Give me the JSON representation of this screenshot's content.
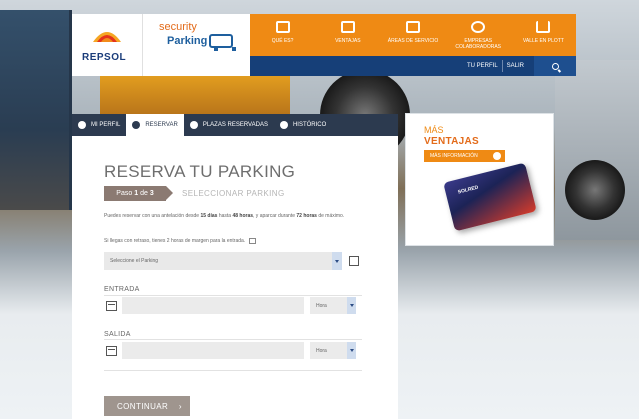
{
  "brand": {
    "company": "REPSOL",
    "product_line1": "security",
    "product_line2": "Parking"
  },
  "nav": {
    "items": [
      {
        "label": "QUÉ ES?",
        "icon": "truck-icon"
      },
      {
        "label": "VENTAJAS",
        "icon": "truck-side-icon"
      },
      {
        "label": "ÁREAS DE SERVICIO",
        "icon": "fuel-pump-icon"
      },
      {
        "label": "EMPRESAS COLABORADORAS",
        "icon": "lifebuoy-icon"
      },
      {
        "label": "VALLE EN PLOTT",
        "icon": "road-icon"
      }
    ],
    "account": {
      "profile": "TU PERFIL",
      "logout": "SALIR"
    }
  },
  "tabs": [
    {
      "label": "MI PERFIL",
      "active": false
    },
    {
      "label": "RESERVAR",
      "active": true
    },
    {
      "label": "PLAZAS RESERVADAS",
      "active": false
    },
    {
      "label": "HISTÓRICO",
      "active": false
    }
  ],
  "reservation": {
    "title": "RESERVA TU PARKING",
    "step": {
      "prefix": "Paso",
      "current": "1",
      "of": "de",
      "total": "3",
      "label": "SELECCIONAR PARKING"
    },
    "intro": {
      "p1": "Puedes reservar con una antelación desde",
      "p1_bold": "15 días",
      "p2": "hasta",
      "p2_bold": "48 horas",
      "p3": ", y aparcar durante",
      "p3_bold": "72 horas",
      "p4": "de máximo."
    },
    "late_notice": "Si llegas con retraso, tienes 2 horas de margen para la entrada.",
    "parking_select": "Seleccione el Parking",
    "entrada": {
      "label": "ENTRADA",
      "time_placeholder": "Hora"
    },
    "salida": {
      "label": "SALIDA",
      "time_placeholder": "Hora"
    },
    "continue_label": "CONTINUAR"
  },
  "promo": {
    "line1": "MÁS",
    "line2": "VENTAJAS",
    "button": "MÁS INFORMACIÓN",
    "card_label": "SOLRED"
  },
  "colors": {
    "orange": "#ef8a14",
    "navy": "#163f78",
    "tab_bg": "#2c3a4f",
    "step_bg": "#8b7a72"
  }
}
